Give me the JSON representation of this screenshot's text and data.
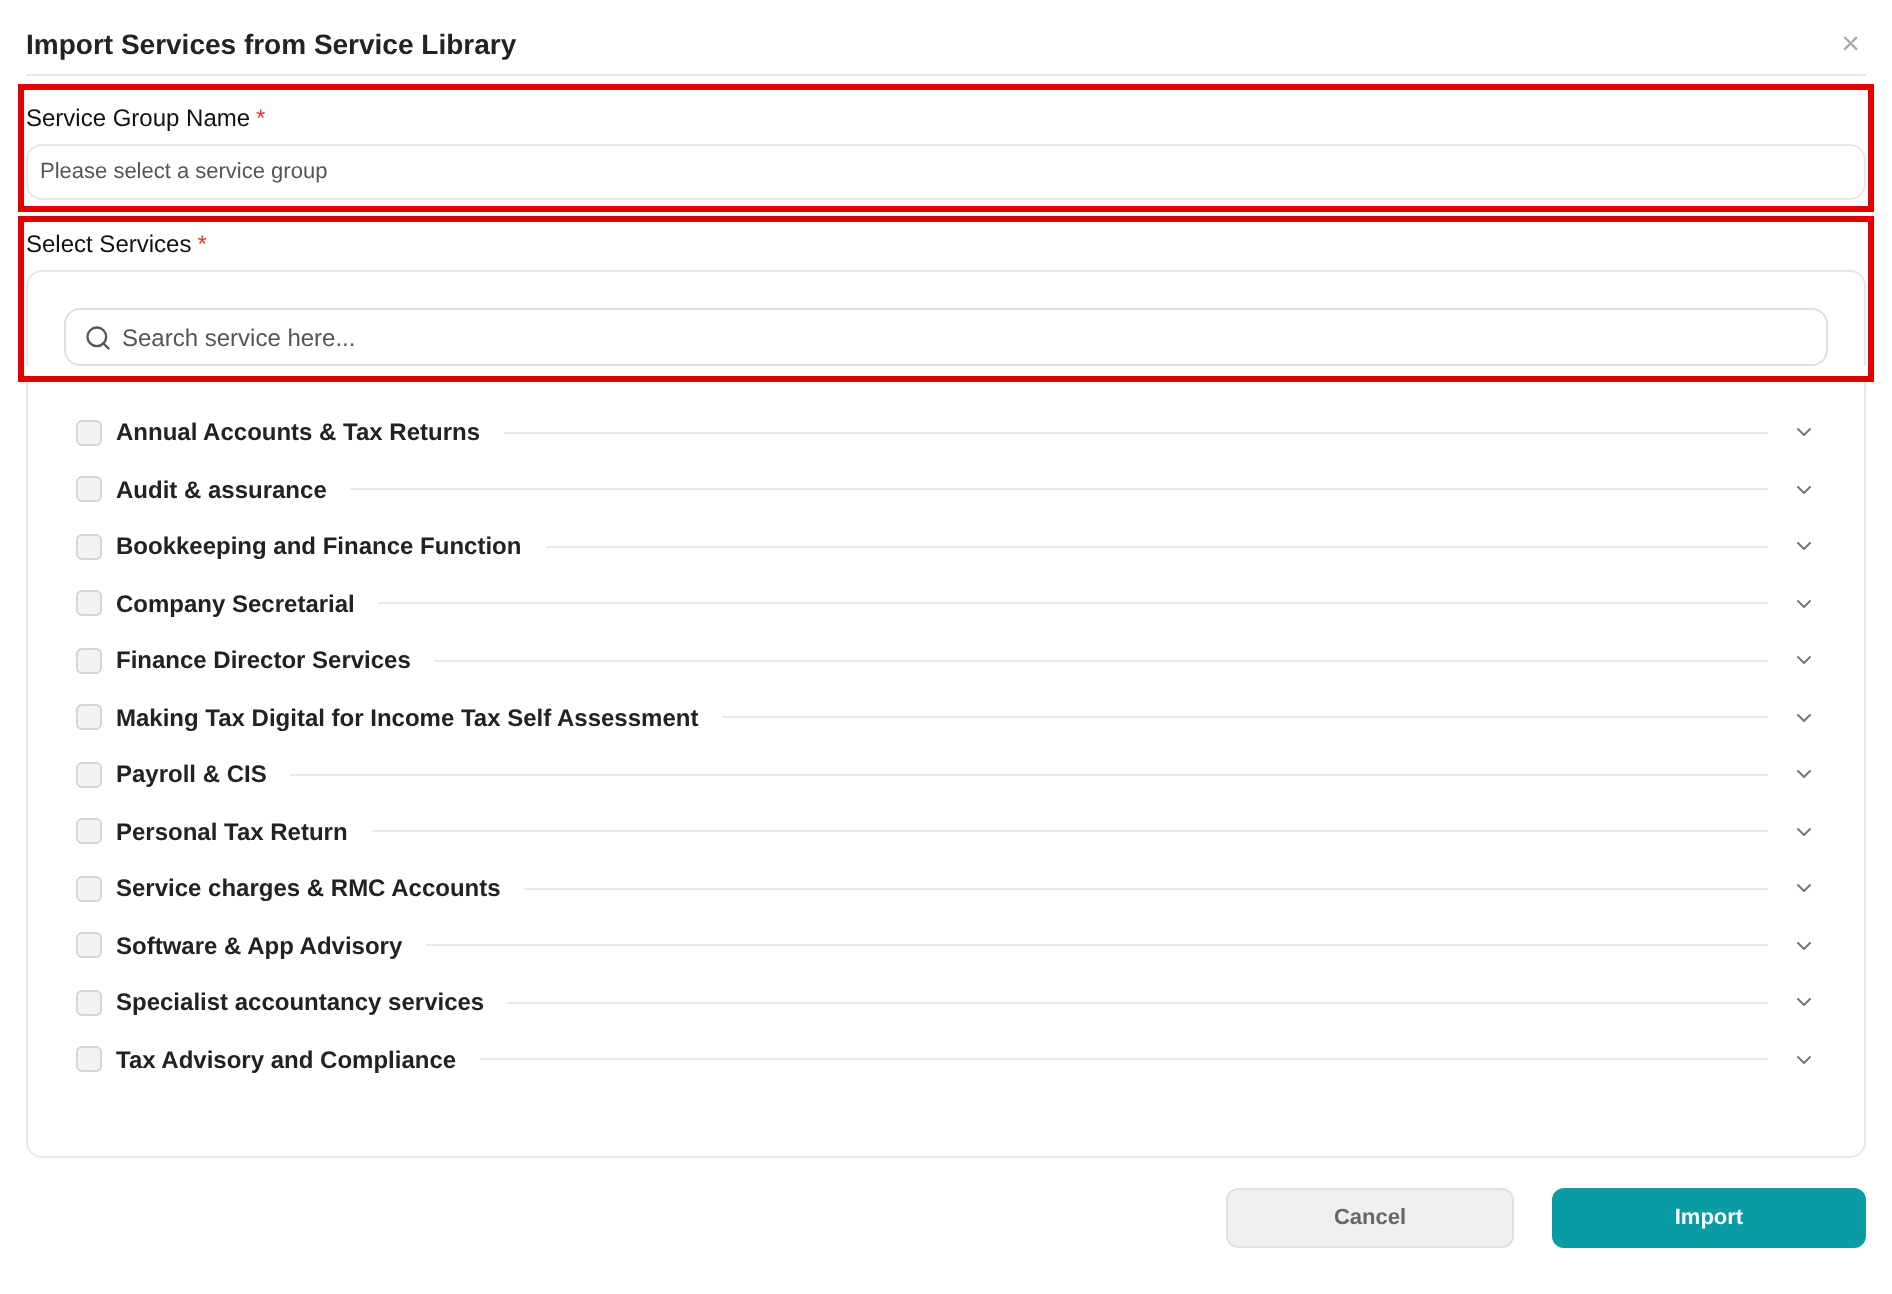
{
  "dialog": {
    "title": "Import Services from Service Library",
    "close": "×"
  },
  "service_group": {
    "label": "Service Group Name",
    "required_mark": "*",
    "placeholder": "Please select a service group",
    "highlighted": true
  },
  "select_services": {
    "label": "Select Services",
    "required_mark": "*",
    "highlighted": true,
    "search": {
      "placeholder": "Search service here..."
    },
    "items": [
      {
        "label": "Annual Accounts & Tax Returns",
        "checked": false,
        "expanded": false
      },
      {
        "label": "Audit & assurance",
        "checked": false,
        "expanded": false
      },
      {
        "label": "Bookkeeping and Finance Function",
        "checked": false,
        "expanded": false
      },
      {
        "label": "Company Secretarial",
        "checked": false,
        "expanded": false
      },
      {
        "label": "Finance Director Services",
        "checked": false,
        "expanded": false
      },
      {
        "label": "Making Tax Digital for Income Tax Self Assessment",
        "checked": false,
        "expanded": false
      },
      {
        "label": "Payroll & CIS",
        "checked": false,
        "expanded": false
      },
      {
        "label": "Personal Tax Return",
        "checked": false,
        "expanded": false
      },
      {
        "label": "Service charges & RMC Accounts",
        "checked": false,
        "expanded": false
      },
      {
        "label": "Software & App Advisory",
        "checked": false,
        "expanded": false
      },
      {
        "label": "Specialist accountancy services",
        "checked": false,
        "expanded": false
      },
      {
        "label": "Tax Advisory and Compliance",
        "checked": false,
        "expanded": false
      }
    ]
  },
  "buttons": [
    {
      "label": "Cancel",
      "kind": "secondary"
    },
    {
      "label": "Import",
      "kind": "primary"
    }
  ]
}
